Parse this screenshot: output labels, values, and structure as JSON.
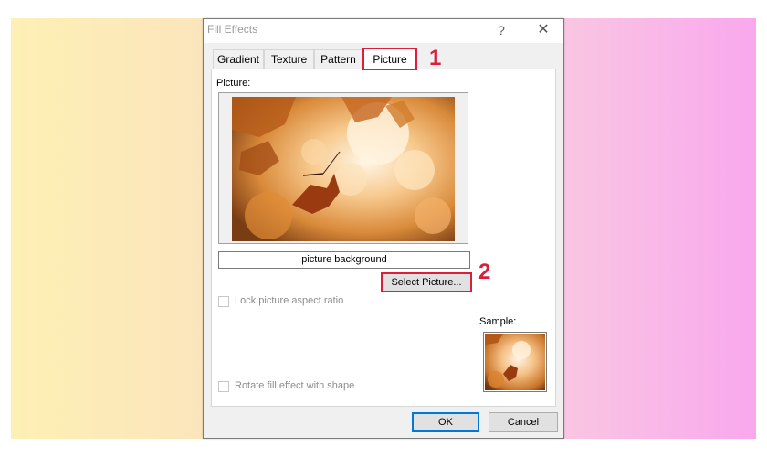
{
  "dialog": {
    "title": "Fill Effects",
    "help_glyph": "?",
    "close_glyph": "✕"
  },
  "tabs": [
    {
      "label": "Gradient"
    },
    {
      "label": "Texture"
    },
    {
      "label": "Pattern"
    },
    {
      "label": "Picture",
      "active": true
    }
  ],
  "picture": {
    "section_label": "Picture:",
    "file_name": "picture background",
    "select_button": "Select Picture..."
  },
  "options": {
    "lock_aspect_label": "Lock picture aspect ratio",
    "rotate_fill_label": "Rotate fill effect with shape"
  },
  "sample": {
    "label": "Sample:"
  },
  "buttons": {
    "ok": "OK",
    "cancel": "Cancel"
  },
  "callouts": {
    "step1": "1",
    "step2": "2"
  },
  "colors": {
    "highlight": "#d81f3c",
    "accent": "#0078d7"
  }
}
